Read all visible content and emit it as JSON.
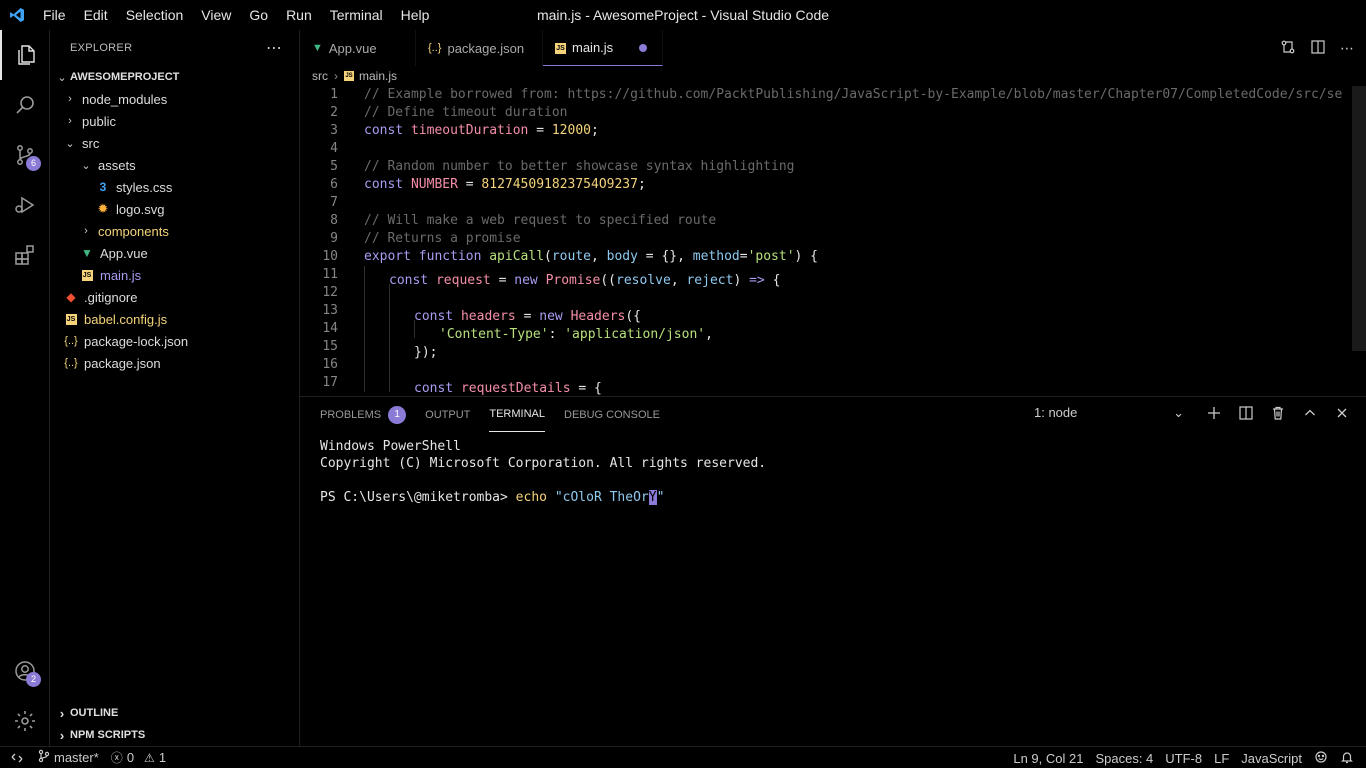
{
  "window": {
    "title": "main.js - AwesomeProject - Visual Studio Code"
  },
  "menu": [
    "File",
    "Edit",
    "Selection",
    "View",
    "Go",
    "Run",
    "Terminal",
    "Help"
  ],
  "activity": {
    "scm_badge": "6",
    "accounts_badge": "2"
  },
  "explorer": {
    "header": "EXPLORER",
    "project": "AWESOMEPROJECT",
    "items": [
      {
        "label": "node_modules",
        "type": "folder",
        "depth": 0,
        "expanded": false
      },
      {
        "label": "public",
        "type": "folder",
        "depth": 0,
        "expanded": false
      },
      {
        "label": "src",
        "type": "folder",
        "depth": 0,
        "expanded": true
      },
      {
        "label": "assets",
        "type": "folder",
        "depth": 1,
        "expanded": true
      },
      {
        "label": "styles.css",
        "type": "css",
        "depth": 2
      },
      {
        "label": "logo.svg",
        "type": "svg",
        "depth": 2
      },
      {
        "label": "components",
        "type": "folder",
        "depth": 1,
        "expanded": false
      },
      {
        "label": "App.vue",
        "type": "vue",
        "depth": 1
      },
      {
        "label": "main.js",
        "type": "js",
        "depth": 1
      },
      {
        "label": ".gitignore",
        "type": "git",
        "depth": 0
      },
      {
        "label": "babel.config.js",
        "type": "js",
        "depth": 0
      },
      {
        "label": "package-lock.json",
        "type": "json",
        "depth": 0
      },
      {
        "label": "package.json",
        "type": "json",
        "depth": 0
      }
    ],
    "outline": "OUTLINE",
    "npm_scripts": "NPM SCRIPTS"
  },
  "tabs": [
    {
      "label": "App.vue",
      "icon": "vue"
    },
    {
      "label": "package.json",
      "icon": "json"
    },
    {
      "label": "main.js",
      "icon": "js",
      "active": true,
      "modified": true
    }
  ],
  "breadcrumb": [
    "src",
    "main.js"
  ],
  "code_lines": [
    "// Example borrowed from: https://github.com/PacktPublishing/JavaScript-by-Example/blob/master/Chapter07/CompletedCode/src/se",
    "// Define timeout duration",
    "const timeoutDuration = 12000;",
    "",
    "// Random number to better showcase syntax highlighting",
    "const NUMBER = 812745091823754O9237;",
    "",
    "// Will make a web request to specified route",
    "// Returns a promise",
    "export function apiCall(route, body = {}, method='post') {",
    "  const request = new Promise((resolve, reject) => {",
    "",
    "    const headers = new Headers({",
    "      'Content-Type': 'application/json',",
    "    });",
    "",
    "    const requestDetails = {"
  ],
  "panel": {
    "tabs": [
      "PROBLEMS",
      "OUTPUT",
      "TERMINAL",
      "DEBUG CONSOLE"
    ],
    "problems_count": "1",
    "terminal_select": "1: node",
    "terminal_lines": [
      "Windows PowerShell",
      "Copyright (C) Microsoft Corporation. All rights reserved."
    ],
    "prompt": "PS C:\\Users\\@miketromba>",
    "command": "echo",
    "arg_before_cursor": "\"cOloR TheOr",
    "cursor_char": "Y",
    "arg_after_cursor": "\""
  },
  "status": {
    "branch": "master*",
    "errors": "0",
    "warnings": "1",
    "position": "Ln 9, Col 21",
    "spaces": "Spaces: 4",
    "encoding": "UTF-8",
    "eol": "LF",
    "language": "JavaScript"
  }
}
